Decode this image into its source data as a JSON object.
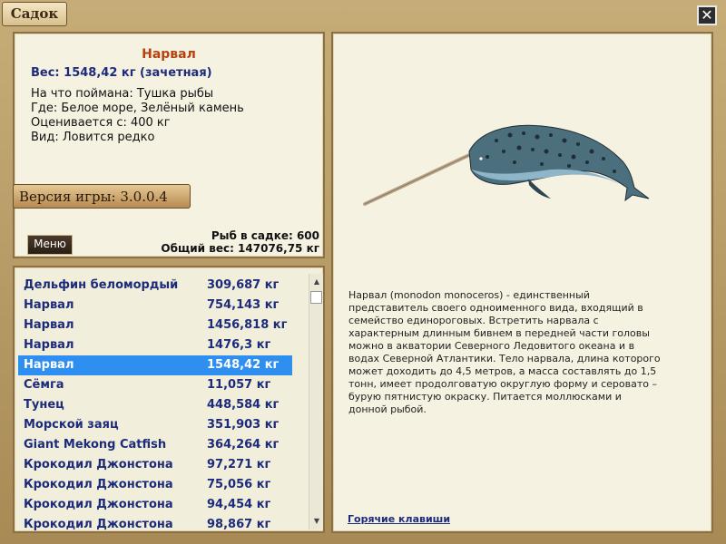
{
  "window": {
    "title": "Садок",
    "close_label": "✕"
  },
  "fish_info": {
    "name": "Нарвал",
    "weight_line": "Вес: 1548,42 кг (зачетная)",
    "details": [
      "На что поймана: Тушка рыбы",
      "Где: Белое море, Зелёный камень",
      "Оценивается с: 400 кг",
      "Вид: Ловится редко"
    ]
  },
  "version_label": "Версия игры: 3.0.0.4",
  "menu_label": "Меню",
  "stats": {
    "fish_count": "Рыб в садке: 600",
    "total_weight": "Общий вес: 147076,75 кг"
  },
  "fish_list": [
    {
      "name": "Дельфин беломордый",
      "weight": "309,687 кг"
    },
    {
      "name": "Нарвал",
      "weight": "754,143 кг"
    },
    {
      "name": "Нарвал",
      "weight": "1456,818 кг"
    },
    {
      "name": "Нарвал",
      "weight": "1476,3 кг"
    },
    {
      "name": "Нарвал",
      "weight": "1548,42 кг"
    },
    {
      "name": "Сёмга",
      "weight": "11,057 кг"
    },
    {
      "name": "Тунец",
      "weight": "448,584 кг"
    },
    {
      "name": "Морской заяц",
      "weight": "351,903 кг"
    },
    {
      "name": "Giant Mekong Catfish",
      "weight": "364,264 кг"
    },
    {
      "name": "Крокодил Джонстона",
      "weight": "97,271 кг"
    },
    {
      "name": "Крокодил Джонстона",
      "weight": "75,056 кг"
    },
    {
      "name": "Крокодил Джонстона",
      "weight": "94,454 кг"
    },
    {
      "name": "Крокодил Джонстона",
      "weight": "98,867 кг"
    }
  ],
  "selected_index": 4,
  "description": "Нарвал (monodon monoceros) - единственный представитель своего одноименного вида, входящий в семейство единороговых. Встретить нарвала с характерным длинным бивнем в передней части головы можно в акватории Северного Ледовитого океана и в водах Северной Атлантики. Тело нарвала, длина которого может доходить до 4,5 метров, а масса составлять до 1,5 тонн, имеет продолговатую округлую форму и серовато – бурую пятнистую окраску. Питается  моллюсками и донной рыбой.",
  "hotkeys_label": "Горячие клавиши",
  "colors": {
    "selected_row": "#2f8ff0",
    "list_text": "#1c2b7a",
    "fish_name": "#b5430f"
  }
}
